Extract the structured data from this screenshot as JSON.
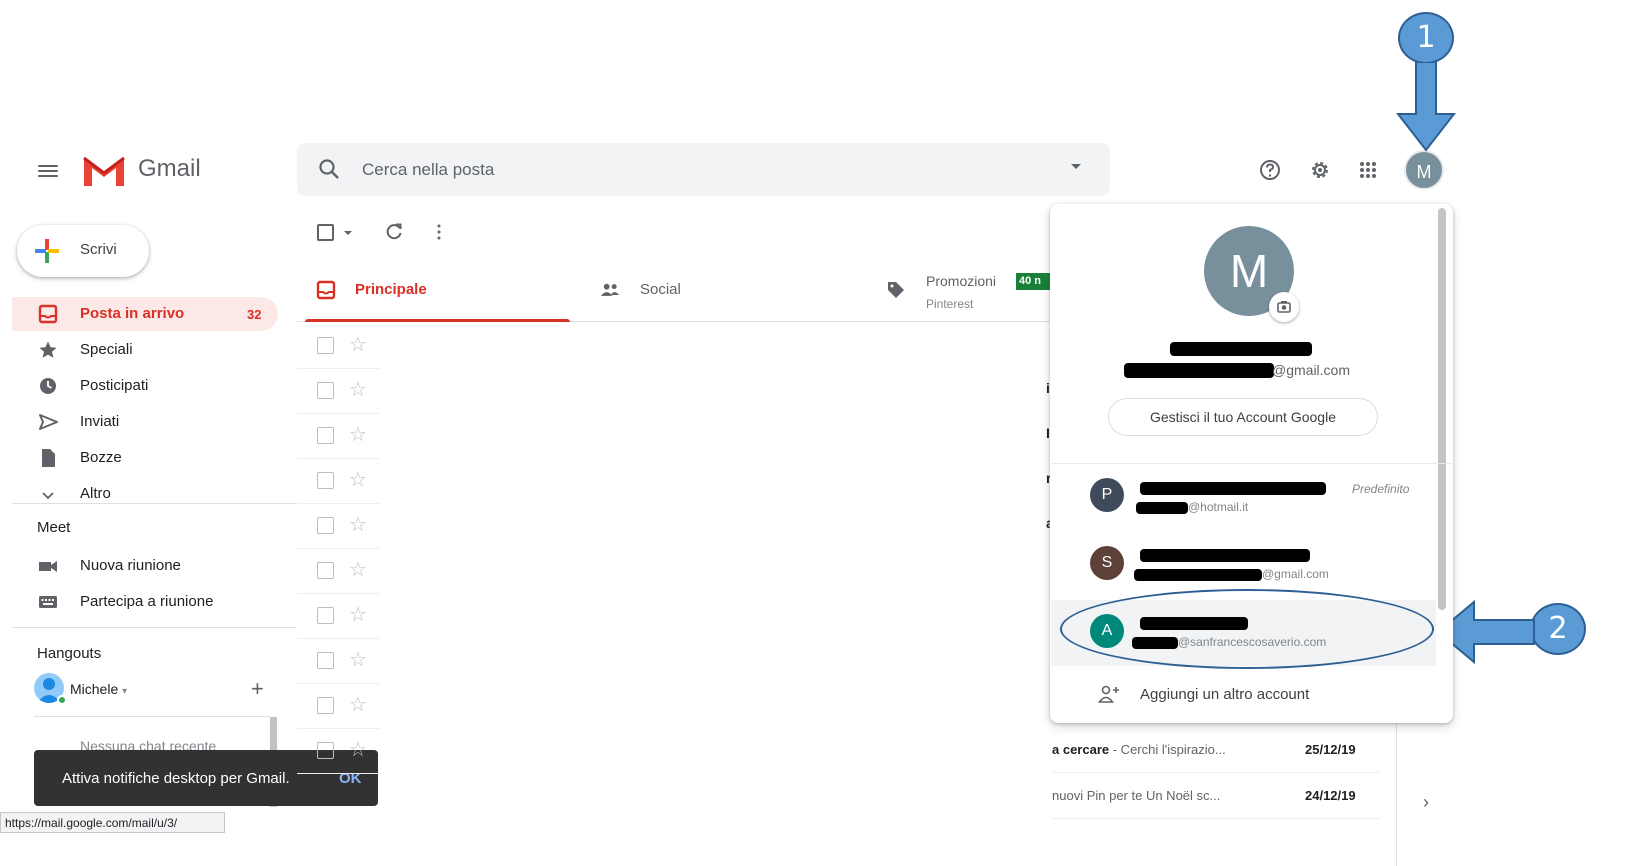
{
  "header": {
    "app_name": "Gmail",
    "search_placeholder": "Cerca nella posta",
    "account_initial": "M"
  },
  "annotations": {
    "badge1": "1",
    "badge2": "2"
  },
  "sidebar": {
    "compose_label": "Scrivi",
    "items": [
      {
        "label": "Posta in arrivo",
        "count": "32",
        "icon": "inbox-icon",
        "active": true
      },
      {
        "label": "Speciali",
        "icon": "star-icon"
      },
      {
        "label": "Posticipati",
        "icon": "clock-icon"
      },
      {
        "label": "Inviati",
        "icon": "send-icon"
      },
      {
        "label": "Bozze",
        "icon": "draft-icon"
      },
      {
        "label": "Altro",
        "icon": "chevron-down-icon"
      }
    ],
    "meet": {
      "title": "Meet",
      "items": [
        {
          "label": "Nuova riunione",
          "icon": "video-icon"
        },
        {
          "label": "Partecipa a riunione",
          "icon": "keyboard-icon"
        }
      ]
    },
    "hangouts": {
      "title": "Hangouts",
      "user": "Michele",
      "no_chat": "Nessuna chat recente"
    }
  },
  "tabs": [
    {
      "label": "Principale",
      "active": true
    },
    {
      "label": "Social"
    },
    {
      "label": "Promozioni",
      "sub": "Pinterest",
      "badge": "40 n"
    }
  ],
  "mail_rows": [
    {
      "bold": "a cercare",
      "snippet": " - Cerchi l'ispirazio...",
      "date": "25/12/19"
    },
    {
      "bold": "",
      "snippet": "nuovi Pin per te Un Noël sc...",
      "date": "24/12/19"
    }
  ],
  "account_menu": {
    "avatar_initial": "M",
    "email_suffix": "@gmail.com",
    "manage_label": "Gestisci il tuo Account Google",
    "accounts": [
      {
        "initial": "P",
        "email_suffix": "@hotmail.it",
        "default_label": "Predefinito",
        "color": "#3f4b5b"
      },
      {
        "initial": "S",
        "email_suffix": "@gmail.com",
        "color": "#5d4037"
      },
      {
        "initial": "A",
        "email_suffix": "@sanfrancescosaverio.com",
        "color": "#00897b"
      }
    ],
    "add_label": "Aggiungi un altro account"
  },
  "toast": {
    "message": "Attiva notifiche desktop per Gmail.",
    "action": "OK"
  },
  "status_url": "https://mail.google.com/mail/u/3/",
  "colors": {
    "red": "#d93025",
    "blue_annotation": "#5b9bd5",
    "green_badge": "#188038"
  }
}
